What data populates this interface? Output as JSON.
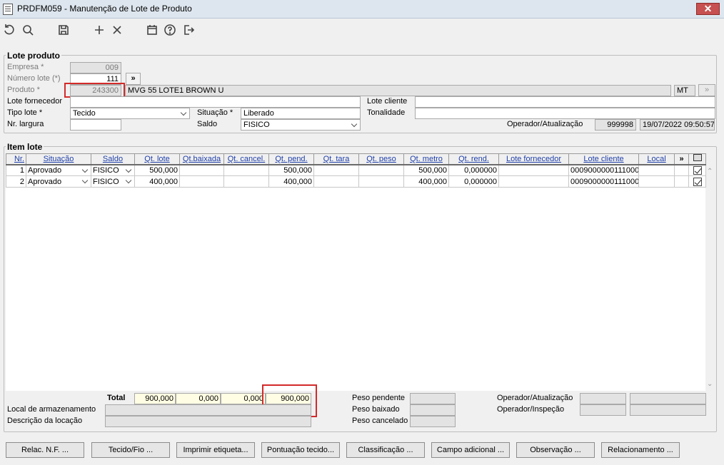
{
  "window": {
    "title": "PRDFM059 - Manutenção de Lote de Produto",
    "close_label": "✕"
  },
  "toolbar": {
    "icons": [
      "refresh-icon",
      "search-icon",
      "save-icon",
      "add-icon",
      "delete-icon",
      "calendar-icon",
      "help-icon",
      "exit-icon"
    ]
  },
  "lote_produto": {
    "group_title": "Lote produto",
    "empresa_label": "Empresa *",
    "empresa_value": "009",
    "numero_lote_label": "Número lote (*)",
    "numero_lote_value": "111",
    "next_button": "»",
    "produto_label": "Produto *",
    "produto_code": "243300",
    "produto_desc": "MVG 55 LOTE1 BROWN U",
    "produto_unit": "MT",
    "lote_fornecedor_label": "Lote fornecedor",
    "lote_fornecedor_value": "",
    "lote_cliente_label": "Lote cliente",
    "lote_cliente_value": "",
    "tipo_lote_label": "Tipo lote *",
    "tipo_lote_value": "Tecido",
    "situacao_label": "Situação *",
    "situacao_value": "Liberado",
    "tonalidade_label": "Tonalidade",
    "tonalidade_value": "",
    "nr_largura_label": "Nr. largura",
    "nr_largura_value": "",
    "saldo_label": "Saldo",
    "saldo_value": "FISICO",
    "operador_label": "Operador/Atualização",
    "operador_value": "999998",
    "atualizacao_value": "19/07/2022 09:50:57"
  },
  "item_lote": {
    "group_title": "Item lote",
    "columns": [
      "Nr.",
      "Situação",
      "Saldo",
      "Qt. lote",
      "Qt.baixada",
      "Qt. cancel.",
      "Qt. pend.",
      "Qt. tara",
      "Qt. peso",
      "Qt. metro",
      "Qt. rend.",
      "Lote fornecedor",
      "Lote cliente",
      "Local"
    ],
    "more_label": "»",
    "rows": [
      {
        "nr": "1",
        "situacao": "Aprovado",
        "saldo": "FISICO",
        "qt_lote": "500,000",
        "qt_baixada": "",
        "qt_cancel": "",
        "qt_pend": "500,000",
        "qt_tara": "",
        "qt_peso": "",
        "qt_metro": "500,000",
        "qt_rend": "0,000000",
        "lote_fornecedor": "",
        "lote_cliente": "0009000000111000",
        "local": ""
      },
      {
        "nr": "2",
        "situacao": "Aprovado",
        "saldo": "FISICO",
        "qt_lote": "400,000",
        "qt_baixada": "",
        "qt_cancel": "",
        "qt_pend": "400,000",
        "qt_tara": "",
        "qt_peso": "",
        "qt_metro": "400,000",
        "qt_rend": "0,000000",
        "lote_fornecedor": "",
        "lote_cliente": "0009000000111000",
        "local": ""
      }
    ],
    "total_label": "Total",
    "total_qt_lote": "900,000",
    "total_qt_baixada": "0,000",
    "total_qt_cancel": "0,000",
    "total_qt_pend": "900,000",
    "local_armazenamento_label": "Local de armazenamento",
    "descricao_locacao_label": "Descrição da locação",
    "peso_pendente_label": "Peso pendente",
    "peso_baixado_label": "Peso baixado",
    "peso_cancelado_label": "Peso cancelado",
    "operador_atualizacao_label": "Operador/Atualização",
    "operador_inspecao_label": "Operador/Inspeção"
  },
  "buttons": [
    "Relac. N.F. ...",
    "Tecido/Fio ...",
    "Imprimir etiqueta...",
    "Pontuação tecido...",
    "Classificação ...",
    "Campo adicional ...",
    "Observação ...",
    "Relacionamento ..."
  ]
}
